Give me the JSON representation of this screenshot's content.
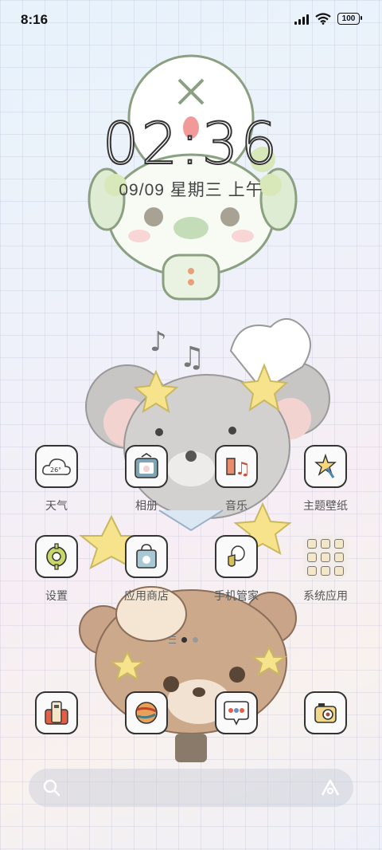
{
  "status_bar": {
    "time": "8:16",
    "battery": "100"
  },
  "lock": {
    "clock": "02:36",
    "date": "09/09 星期三 上午"
  },
  "apps_row1": [
    {
      "label": "天气",
      "icon": "weather-icon",
      "temp": "26°"
    },
    {
      "label": "相册",
      "icon": "gallery-icon"
    },
    {
      "label": "音乐",
      "icon": "music-icon"
    },
    {
      "label": "主题壁纸",
      "icon": "theme-icon"
    }
  ],
  "apps_row2": [
    {
      "label": "设置",
      "icon": "settings-icon"
    },
    {
      "label": "应用商店",
      "icon": "app-store-icon"
    },
    {
      "label": "手机管家",
      "icon": "security-icon"
    },
    {
      "label": "系统应用",
      "icon": "folder-icon"
    }
  ],
  "dock": [
    {
      "icon": "phone-icon"
    },
    {
      "icon": "browser-icon"
    },
    {
      "icon": "messages-icon"
    },
    {
      "icon": "camera-icon"
    }
  ],
  "colors": {
    "accent_pink": "#f29a9a",
    "bear_brown": "#c9a488",
    "mouse_grey": "#c8c6c4"
  }
}
